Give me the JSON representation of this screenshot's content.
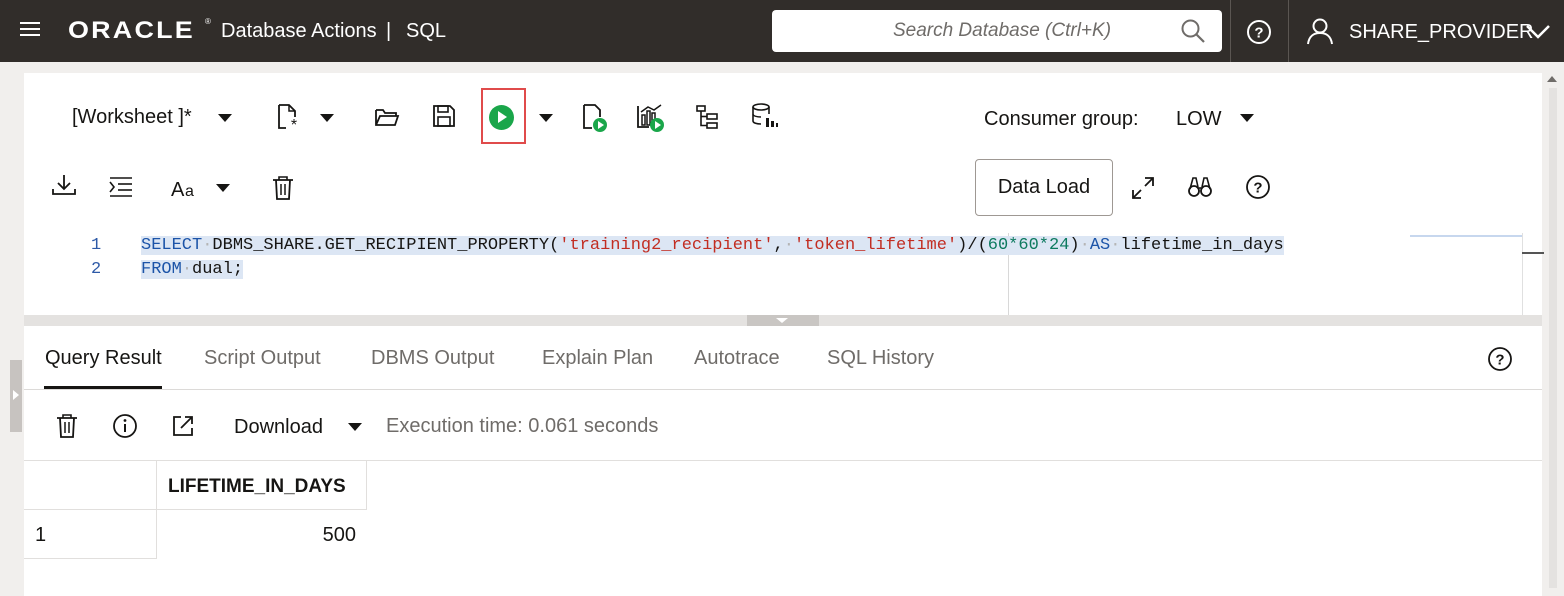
{
  "header": {
    "brand": "ORACLE",
    "brand_mark": "®",
    "app_title": "Database Actions",
    "separator": "|",
    "section": "SQL",
    "search_placeholder": "Search Database (Ctrl+K)",
    "user": "SHARE_PROVIDER",
    "bg_color": "#312d2a"
  },
  "toolbar": {
    "worksheet_label": "[Worksheet ]*",
    "consumer_group_label": "Consumer group:",
    "consumer_group_value": "LOW",
    "data_load_label": "Data Load",
    "run_highlight_color": "#e04b4b",
    "run_color": "#1aa64a"
  },
  "editor": {
    "line_numbers": [
      "1",
      "2"
    ],
    "lines": [
      {
        "t1": "SELECT",
        "t2": "DBMS_SHARE.GET_RECIPIENT_PROPERTY(",
        "t3": "'training2_recipient'",
        "t4": ",",
        "t5": "'token_lifetime'",
        "t6": ")/(",
        "t7": "60*60*24",
        "t8": ")",
        "t9": "AS",
        "t10": "lifetime_in_days"
      },
      {
        "t1": "FROM",
        "t2": "dual;"
      }
    ]
  },
  "results": {
    "tabs": [
      {
        "label": "Query Result",
        "active": true
      },
      {
        "label": "Script Output"
      },
      {
        "label": "DBMS Output"
      },
      {
        "label": "Explain Plan"
      },
      {
        "label": "Autotrace"
      },
      {
        "label": "SQL History"
      }
    ],
    "download_label": "Download",
    "execution_time": "Execution time: 0.061 seconds",
    "columns": [
      "LIFETIME_IN_DAYS"
    ],
    "rows": [
      {
        "row_number": "1",
        "cells": [
          "500"
        ]
      }
    ]
  }
}
